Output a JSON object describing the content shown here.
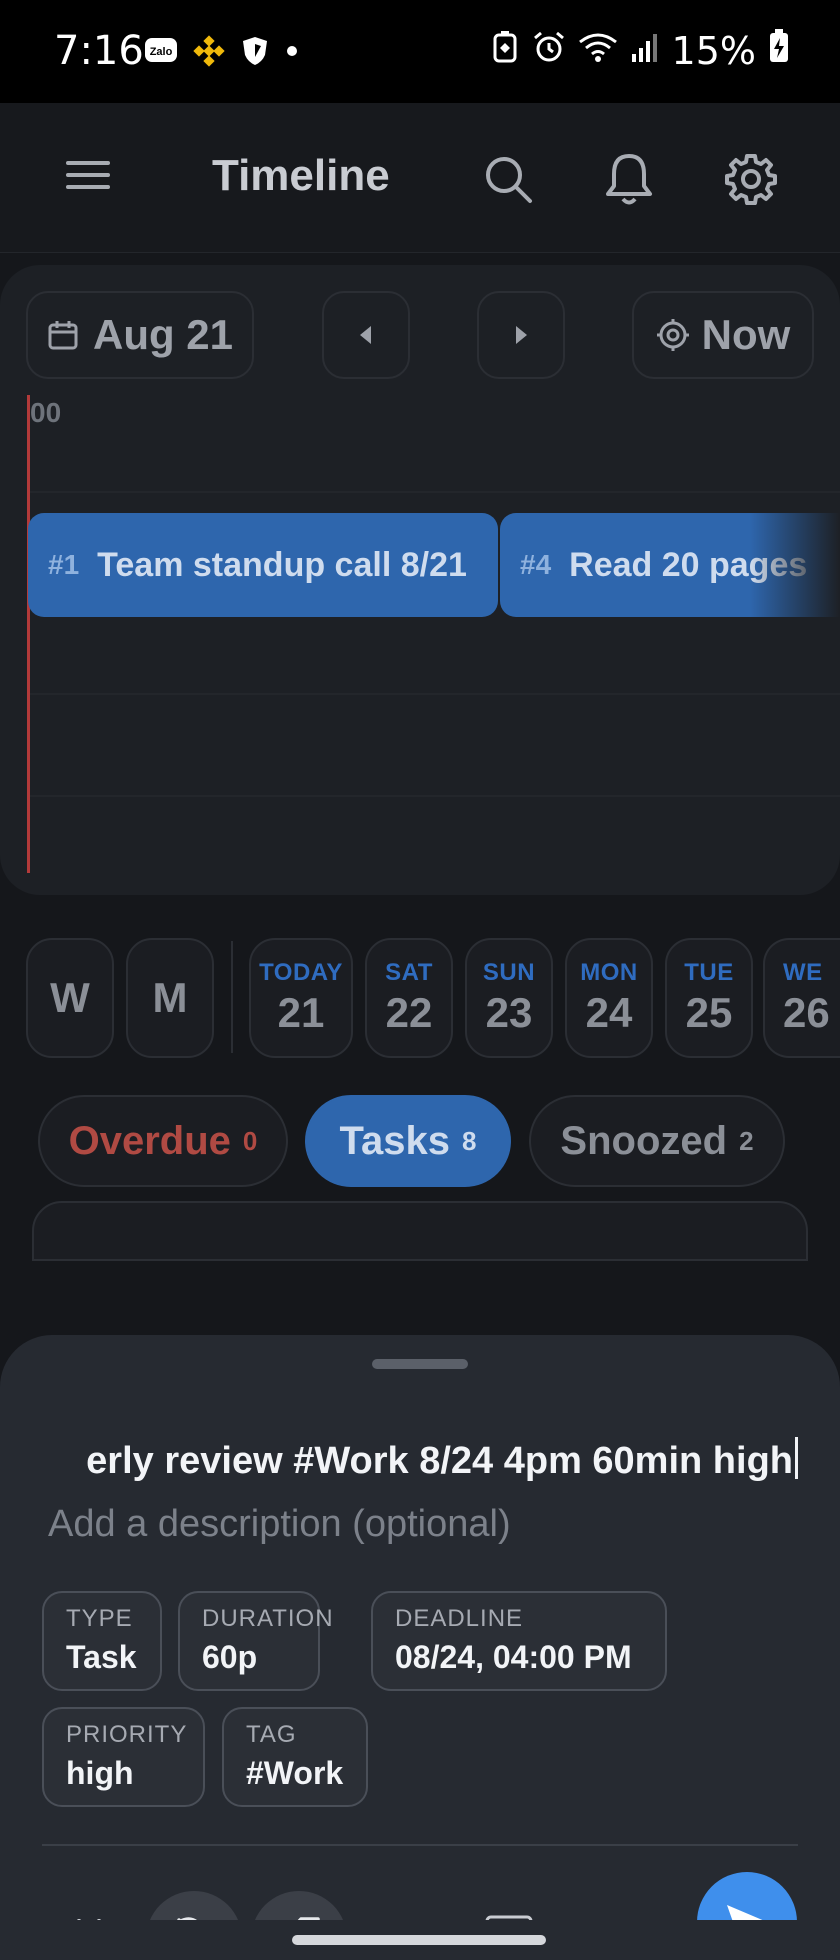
{
  "status_bar": {
    "time": "7:16",
    "left_icons": [
      "zalo-icon",
      "binance-icon",
      "vpn-shield-icon",
      "dot-icon"
    ],
    "zalo_label": "Zalo",
    "battery": "15%"
  },
  "header": {
    "title": "Timeline"
  },
  "timeline": {
    "date_label": "Aug 21",
    "now_label": "Now",
    "hour_label": "00",
    "tasks": [
      {
        "num": "#1",
        "title": "Team standup call 8/21"
      },
      {
        "num": "#4",
        "title": "Read 20 pages"
      }
    ]
  },
  "day_picker": {
    "view_week": "W",
    "view_month": "M",
    "days": [
      {
        "name": "TODAY",
        "num": "21"
      },
      {
        "name": "SAT",
        "num": "22"
      },
      {
        "name": "SUN",
        "num": "23"
      },
      {
        "name": "MON",
        "num": "24"
      },
      {
        "name": "TUE",
        "num": "25"
      },
      {
        "name": "WE",
        "num": "26"
      }
    ]
  },
  "filters": {
    "overdue": {
      "label": "Overdue",
      "count": "0"
    },
    "tasks": {
      "label": "Tasks",
      "count": "8"
    },
    "snoozed": {
      "label": "Snoozed",
      "count": "2"
    }
  },
  "sheet": {
    "title_value": "erly review #Work 8/24 4pm 60min high",
    "description_placeholder": "Add a description (optional)",
    "props": {
      "type": {
        "label": "TYPE",
        "value": "Task"
      },
      "duration": {
        "label": "DURATION",
        "value": "60p"
      },
      "deadline": {
        "label": "DEADLINE",
        "value": "08/24, 04:00 PM"
      },
      "priority": {
        "label": "PRIORITY",
        "value": "high"
      },
      "tag": {
        "label": "TAG",
        "value": "#Work"
      }
    },
    "ai_label": "Ai"
  },
  "colors": {
    "accent": "#3f8fec",
    "overdue": "#c0463f",
    "task_block": "#2e66ad",
    "sheet_bg": "#262a31"
  }
}
